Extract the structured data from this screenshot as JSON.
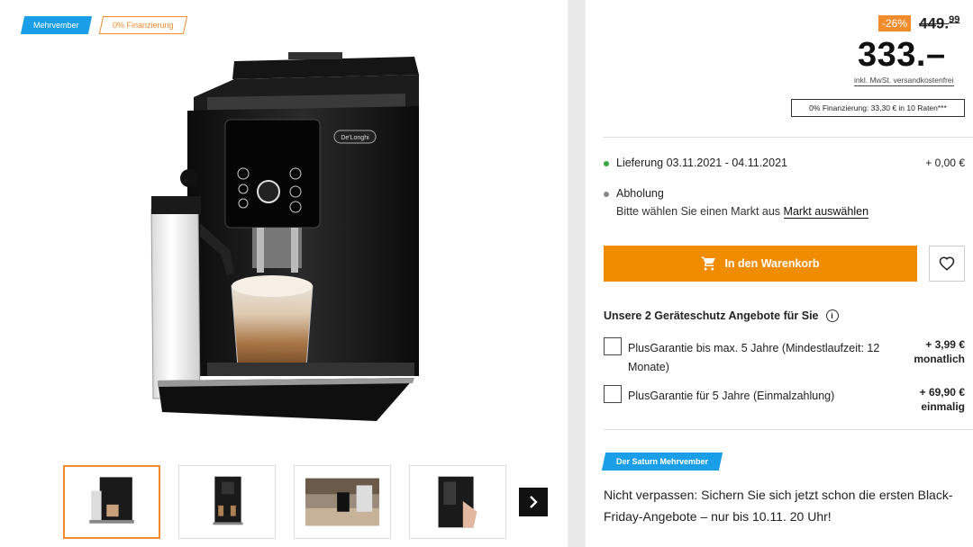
{
  "badges": {
    "mehrvember": "Mehrvember",
    "financing": "0% Finanzierung"
  },
  "product": {
    "image_alt": "De'Longhi Cappuccino Smart Kaffeevollautomat",
    "brand_text": "De'Longhi",
    "thumbnails": [
      "thumbnail-1",
      "thumbnail-2",
      "thumbnail-3",
      "thumbnail-4"
    ]
  },
  "price": {
    "discount": "-26%",
    "old_price_main": "449.",
    "old_price_cents": "99",
    "new_price": "333.–",
    "tax_note": "inkl. MwSt. versandkostenfrei",
    "financing": "0% Finanzierung: 33,30 € in 10 Raten***"
  },
  "delivery": {
    "label": "Lieferung 03.11.2021 - 04.11.2021",
    "price": "+ 0,00 €",
    "pickup_label": "Abholung",
    "pickup_text": "Bitte wählen Sie einen Markt aus",
    "pickup_link": "Markt auswählen"
  },
  "cart": {
    "label": "In den Warenkorb"
  },
  "warranty": {
    "title": "Unsere 2 Geräteschutz Angebote für Sie",
    "options": [
      {
        "label": "PlusGarantie bis max. 5 Jahre (Mindestlaufzeit: 12 Monate)",
        "price": "+ 3,99 €",
        "period": "monatlich"
      },
      {
        "label": "PlusGarantie für 5 Jahre (Einmalzahlung)",
        "price": "+ 69,90 €",
        "period": "einmalig"
      }
    ]
  },
  "promo": {
    "badge": "Der Saturn Mehrvember",
    "text": "Nicht verpassen: Sichern Sie sich jetzt schon die ersten Black-Friday-Angebote – nur bis 10.11. 20 Uhr!"
  },
  "colors": {
    "accent_orange": "#f08c00",
    "badge_blue": "#1a9ee8",
    "green": "#37a83b"
  }
}
